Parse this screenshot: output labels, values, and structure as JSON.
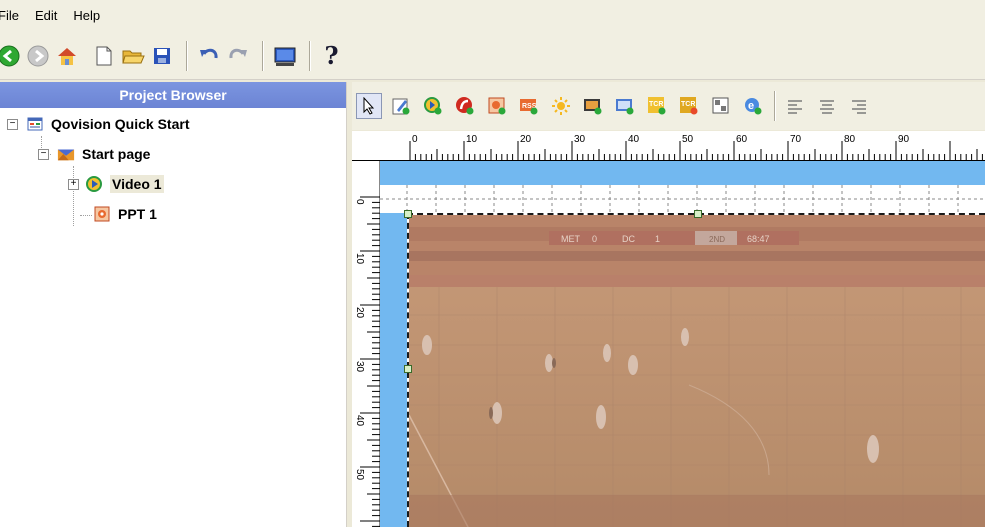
{
  "menu": {
    "file": "File",
    "edit": "Edit",
    "help": "Help"
  },
  "toolbar": {
    "icons": [
      "back-icon",
      "forward-icon",
      "home-icon",
      "new-icon",
      "open-icon",
      "save-icon",
      "undo-icon",
      "redo-icon",
      "preview-icon",
      "help-icon"
    ],
    "help_glyph": "?"
  },
  "project_browser": {
    "title": "Project Browser",
    "tree": {
      "root": "Qovision Quick Start",
      "page": "Start page",
      "video": "Video 1",
      "ppt": "PPT 1"
    }
  },
  "editor_toolbar": {
    "icons": [
      "select-arrow-icon",
      "edit-text-icon",
      "add-media-icon",
      "add-flash-icon",
      "add-ppt-icon",
      "add-rss-icon",
      "add-effect-icon",
      "add-image-icon",
      "add-picture-icon",
      "add-ticker-icon",
      "add-ticker2-icon",
      "add-layout-icon",
      "add-web-icon",
      "align-left-icon",
      "align-center-icon",
      "align-right-icon"
    ]
  },
  "ruler": {
    "h_numbers": [
      "0",
      "10",
      "20",
      "30",
      "40",
      "50",
      "60",
      "70",
      "80",
      "90"
    ],
    "v_numbers": [
      "0",
      "10",
      "20",
      "30",
      "40",
      "50"
    ]
  },
  "scoreboard": {
    "team1": "MET",
    "score1": "0",
    "team2": "DC",
    "score2": "1",
    "period": "2ND",
    "clock": "68:47"
  },
  "colors": {
    "canvas_bg": "#72b8f0",
    "header_bg": "#7b95e0",
    "video_tint": "#b88f6e"
  }
}
